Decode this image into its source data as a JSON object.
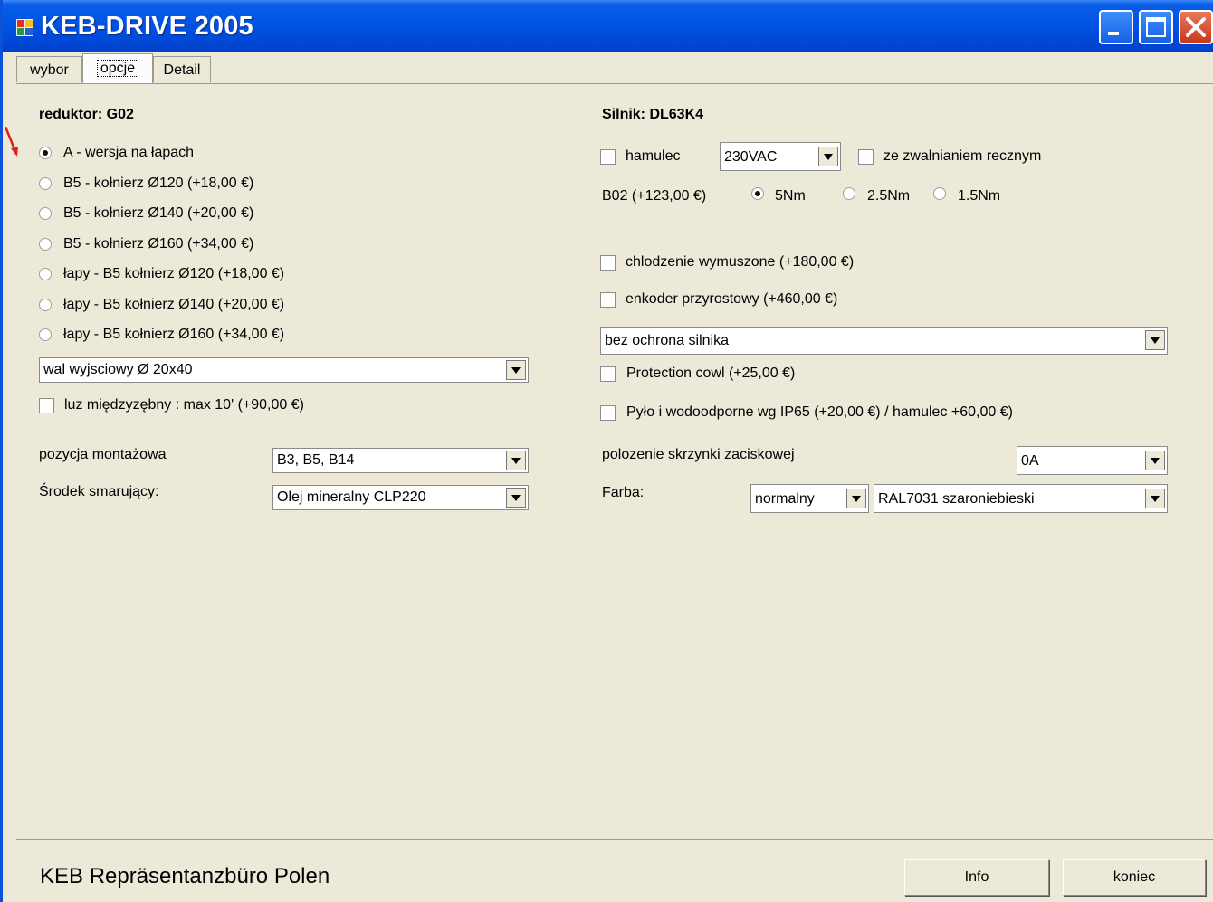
{
  "window": {
    "title": "KEB-DRIVE 2005"
  },
  "tabs": [
    {
      "label": "wybor",
      "active": false
    },
    {
      "label": "opcje",
      "active": true
    },
    {
      "label": "Detail",
      "active": false
    }
  ],
  "reduktor": {
    "heading": "reduktor: G02",
    "radios": [
      {
        "label": "A - wersja na łapach",
        "checked": true
      },
      {
        "label": "B5 - kołnierz Ø120 (+18,00 €)",
        "checked": false
      },
      {
        "label": "B5 - kołnierz Ø140 (+20,00 €)",
        "checked": false
      },
      {
        "label": "B5 - kołnierz Ø160 (+34,00 €)",
        "checked": false
      },
      {
        "label": "łapy - B5 kołnierz Ø120 (+18,00 €)",
        "checked": false
      },
      {
        "label": "łapy - B5 kołnierz Ø140 (+20,00 €)",
        "checked": false
      },
      {
        "label": "łapy - B5 kołnierz Ø160 (+34,00 €)",
        "checked": false
      }
    ],
    "shaft_combo": "wal wyjsciowy Ø 20x40",
    "backlash_check": "luz międzyzębny : max 10' (+90,00 €)",
    "mount_label": "pozycja montażowa",
    "mount_value": "B3, B5, B14",
    "lube_label": "Środek smarujący:",
    "lube_value": "Olej mineralny CLP220"
  },
  "silnik": {
    "heading": "Silnik: DL63K4",
    "brake_check": "hamulec",
    "brake_voltage": "230VAC",
    "manual_release_check": "ze zwalnianiem recznym",
    "brake_label": "B02 (+123,00 €)",
    "torque_radios": [
      {
        "label": "5Nm",
        "checked": true
      },
      {
        "label": "2.5Nm",
        "checked": false
      },
      {
        "label": "1.5Nm",
        "checked": false
      }
    ],
    "forced_cooling_check": "chlodzenie wymuszone (+180,00 €)",
    "encoder_check": "enkoder przyrostowy (+460,00 €)",
    "protection_combo": "bez ochrona silnika",
    "cowl_check": "Protection cowl (+25,00 €)",
    "ip65_check": "Pyło i wodoodporne wg IP65 (+20,00 €) / hamulec +60,00 €)",
    "terminal_label": "polozenie skrzynki zaciskowej",
    "terminal_value": "0A",
    "paint_label": "Farba:",
    "paint_type": "normalny",
    "paint_color": "RAL7031 szaroniebieski"
  },
  "footer": {
    "company": "KEB Repräsentanzbüro Polen",
    "info_button": "Info",
    "exit_button": "koniec"
  },
  "colors": {
    "titlebar": "#0055e5",
    "face": "#ece9d8",
    "close": "#c9391a"
  }
}
